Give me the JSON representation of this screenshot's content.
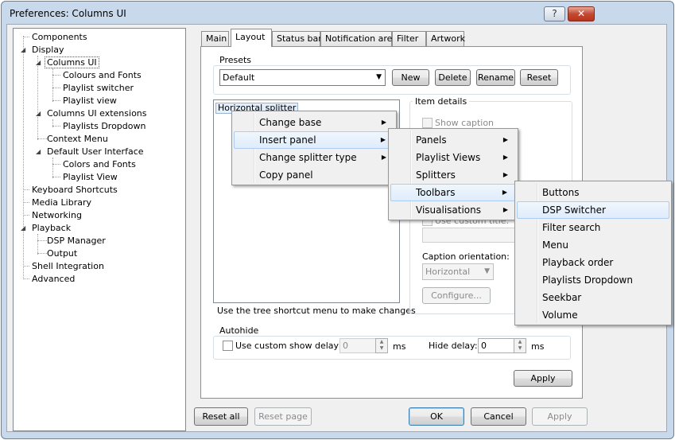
{
  "window": {
    "title": "Preferences: Columns UI",
    "help_label": "?",
    "close_label": "✕"
  },
  "tree": {
    "items": [
      {
        "label": "Components"
      },
      {
        "label": "Display"
      },
      {
        "label": "Columns UI"
      },
      {
        "label": "Colours and Fonts"
      },
      {
        "label": "Playlist switcher"
      },
      {
        "label": "Playlist view"
      },
      {
        "label": "Columns UI extensions"
      },
      {
        "label": "Playlists Dropdown"
      },
      {
        "label": "Context Menu"
      },
      {
        "label": "Default User Interface"
      },
      {
        "label": "Colors and Fonts"
      },
      {
        "label": "Playlist View"
      },
      {
        "label": "Keyboard Shortcuts"
      },
      {
        "label": "Media Library"
      },
      {
        "label": "Networking"
      },
      {
        "label": "Playback"
      },
      {
        "label": "DSP Manager"
      },
      {
        "label": "Output"
      },
      {
        "label": "Shell Integration"
      },
      {
        "label": "Advanced"
      }
    ],
    "expanded_icon": "◢"
  },
  "tabs": [
    "Main",
    "Layout",
    "Status bar",
    "Notification area",
    "Filter",
    "Artwork"
  ],
  "presets": {
    "label": "Presets",
    "selected": "Default",
    "buttons": {
      "new": "New",
      "delete": "Delete",
      "rename": "Rename",
      "reset": "Reset"
    }
  },
  "layout_tree": {
    "root": "Horizontal splitter",
    "hint": "Use the tree shortcut menu to make changes"
  },
  "item_details": {
    "label": "Item details",
    "show_caption": "Show caption",
    "use_custom_title": "Use custom title:",
    "caption_orientation_label": "Caption orientation:",
    "caption_orientation": "Horizontal",
    "configure": "Configure..."
  },
  "autohide": {
    "label": "Autohide",
    "custom_delay_label": "Use custom show delay of",
    "show_delay": "0",
    "ms1": "ms",
    "hide_delay_label": "Hide delay:",
    "hide_delay": "0",
    "ms2": "ms"
  },
  "panel_apply": "Apply",
  "footer": {
    "reset_all": "Reset all",
    "reset_page": "Reset page",
    "ok": "OK",
    "cancel": "Cancel",
    "apply": "Apply"
  },
  "menus": {
    "context": [
      "Change base",
      "Insert panel",
      "Change splitter type",
      "Copy panel"
    ],
    "insert_panel": [
      "Panels",
      "Playlist Views",
      "Splitters",
      "Toolbars",
      "Visualisations"
    ],
    "toolbars": [
      "Buttons",
      "DSP Switcher",
      "Filter search",
      "Menu",
      "Playback order",
      "Playlists Dropdown",
      "Seekbar",
      "Volume"
    ],
    "submenu_arrow": "▶",
    "dropdown_arrow": "▼"
  }
}
